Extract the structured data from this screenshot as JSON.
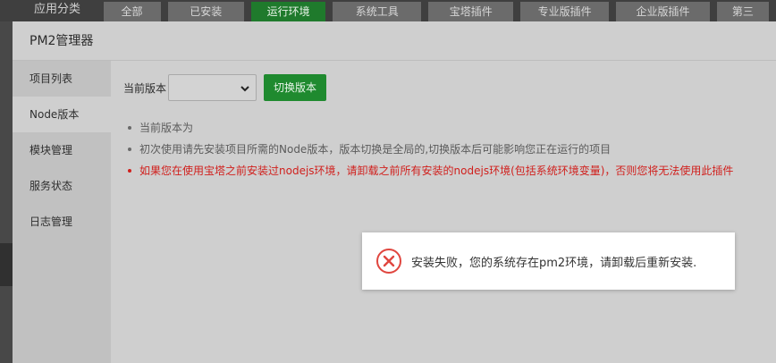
{
  "top_tabs": {
    "category_label": "应用分类",
    "items": [
      {
        "label": "全部",
        "active": false
      },
      {
        "label": "已安装",
        "active": false
      },
      {
        "label": "运行环境",
        "active": true
      },
      {
        "label": "系统工具",
        "active": false
      },
      {
        "label": "宝塔插件",
        "active": false
      },
      {
        "label": "专业版插件",
        "active": false
      },
      {
        "label": "企业版插件",
        "active": false
      },
      {
        "label": "第三",
        "active": false
      }
    ]
  },
  "modal": {
    "title": "PM2管理器",
    "sidebar": [
      {
        "label": "项目列表",
        "active": false
      },
      {
        "label": "Node版本",
        "active": true
      },
      {
        "label": "模块管理",
        "active": false
      },
      {
        "label": "服务状态",
        "active": false
      },
      {
        "label": "日志管理",
        "active": false
      }
    ],
    "version": {
      "label": "当前版本",
      "selected": "",
      "switch_label": "切换版本"
    },
    "notes": [
      {
        "text": "当前版本为",
        "warn": false
      },
      {
        "text": "初次使用请先安装项目所需的Node版本，版本切换是全局的,切换版本后可能影响您正在运行的项目",
        "warn": false
      },
      {
        "text": "如果您在使用宝塔之前安装过nodejs环境，请卸载之前所有安装的nodejs环境(包括系统环境变量)，否则您将无法使用此插件",
        "warn": true
      }
    ]
  },
  "toast": {
    "icon": "error-circle-icon",
    "message": "安装失败，您的系统存在pm2环境，请卸载后重新安装."
  },
  "colors": {
    "accent_green": "#1f8a2f",
    "warning_red": "#d0201d",
    "error_icon": "#e0463f"
  }
}
